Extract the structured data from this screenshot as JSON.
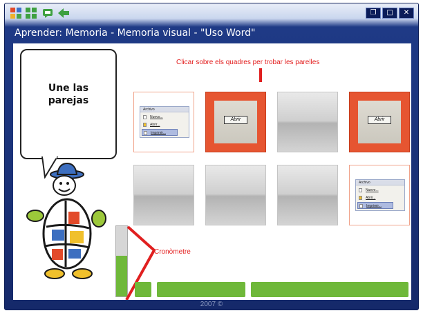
{
  "toolbar": {
    "menu_icon": "apps-grid-icon",
    "menu2_icon": "apps-grid-icon",
    "help_icon": "chat-icon",
    "back_icon": "back-arrow-icon",
    "window_buttons": [
      "restore-icon",
      "maximize-icon",
      "close-icon"
    ]
  },
  "window": {
    "title": "Aprender: Memoria - Memoria visual - \"Uso Word\"",
    "footer": "2007 ©"
  },
  "activity": {
    "bubble_text": "Une las\nparejas",
    "instruction": "Clicar sobre els quadres per trobar les parelles",
    "chrono_label": "Cronòmetre",
    "chrono_level": 0.58
  },
  "cards": [
    {
      "state": "face-up",
      "kind": "menu"
    },
    {
      "state": "selected",
      "kind": "button",
      "label": "Abrir"
    },
    {
      "state": "face-down"
    },
    {
      "state": "selected",
      "kind": "button",
      "label": "Abrir"
    },
    {
      "state": "face-down"
    },
    {
      "state": "face-down"
    },
    {
      "state": "face-down"
    },
    {
      "state": "face-up",
      "kind": "menu"
    }
  ],
  "menu_thumb": {
    "header": "Archivo",
    "items": [
      "Nuevo...",
      "Abrir...",
      "Imprimir..."
    ]
  },
  "colors": {
    "accent_red": "#e32121",
    "card_selected": "#e65531",
    "progress_green": "#6fb83a",
    "frame_blue": "#15296a"
  }
}
